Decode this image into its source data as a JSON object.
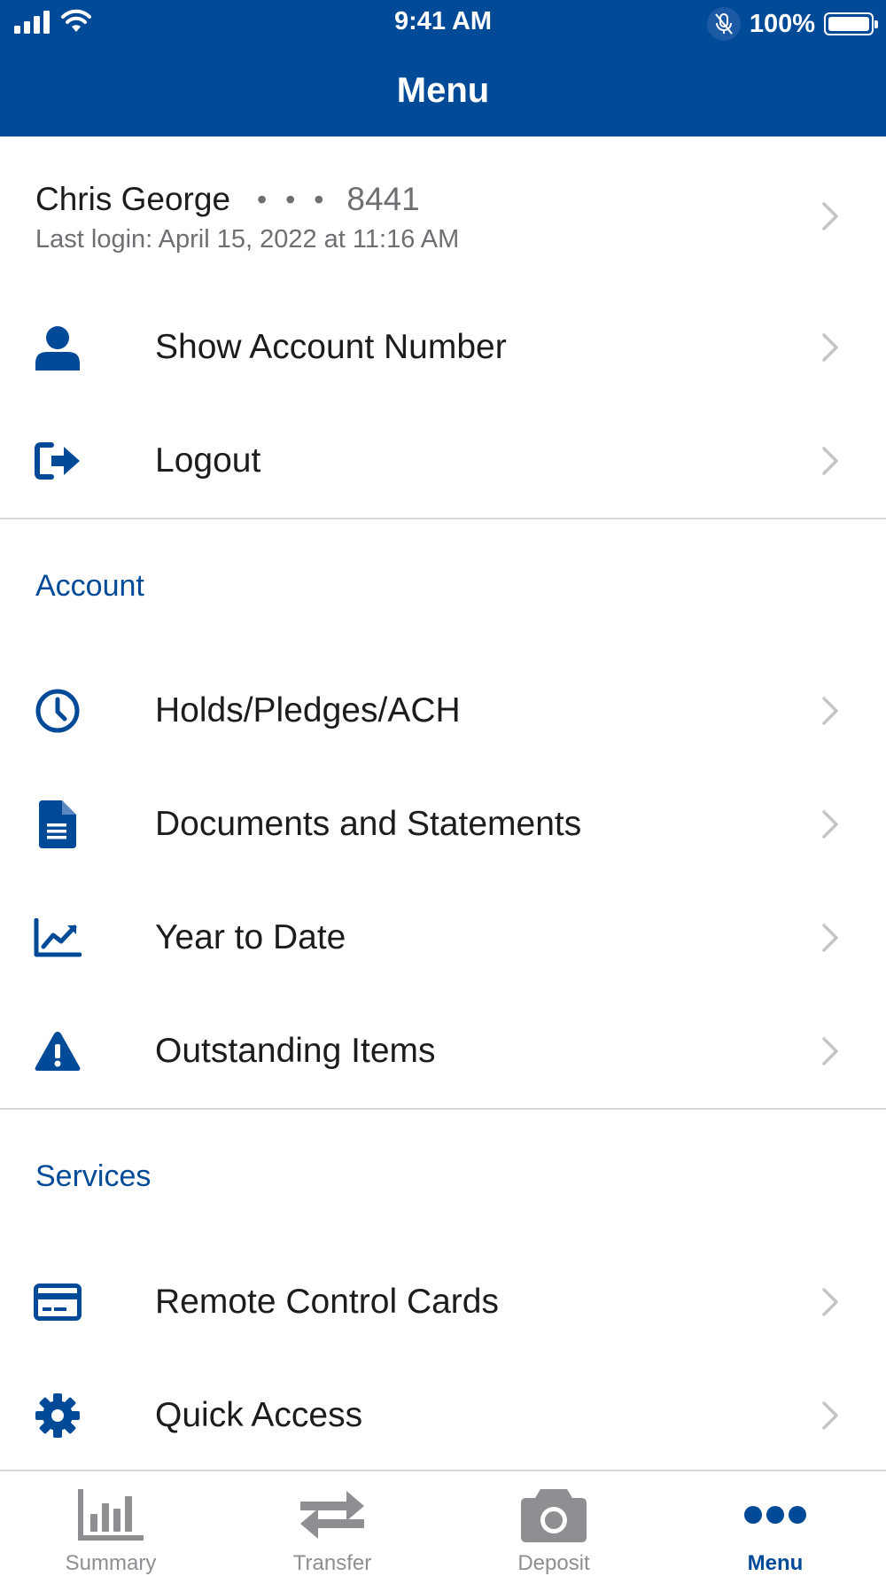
{
  "status_bar": {
    "time": "9:41 AM",
    "battery": "100%"
  },
  "header": {
    "title": "Menu"
  },
  "user": {
    "name": "Chris George",
    "masked_dots": "• • •",
    "account_suffix": "8441",
    "last_login": "Last login: April 15, 2022 at 11:16 AM"
  },
  "top_items": [
    {
      "label": "Show Account Number",
      "icon": "person-icon"
    },
    {
      "label": "Logout",
      "icon": "logout-icon"
    }
  ],
  "sections": {
    "account": {
      "title": "Account",
      "items": [
        {
          "label": "Holds/Pledges/ACH",
          "icon": "clock-icon"
        },
        {
          "label": "Documents and Statements",
          "icon": "document-icon"
        },
        {
          "label": "Year to Date",
          "icon": "chart-trend-icon"
        },
        {
          "label": "Outstanding Items",
          "icon": "warning-icon"
        }
      ]
    },
    "services": {
      "title": "Services",
      "items": [
        {
          "label": "Remote Control Cards",
          "icon": "credit-card-icon"
        },
        {
          "label": "Quick Access",
          "icon": "gear-icon"
        }
      ]
    }
  },
  "tabbar": {
    "tabs": [
      {
        "label": "Summary",
        "icon": "bar-chart-icon"
      },
      {
        "label": "Transfer",
        "icon": "transfer-arrows-icon"
      },
      {
        "label": "Deposit",
        "icon": "camera-icon"
      },
      {
        "label": "Menu",
        "icon": "more-dots-icon",
        "active": true
      }
    ]
  },
  "colors": {
    "brand": "#004a97",
    "text": "#1c1c1e",
    "muted": "#6e6e73",
    "inactive_tab": "#8e8e93",
    "divider": "#d9d9dc"
  }
}
